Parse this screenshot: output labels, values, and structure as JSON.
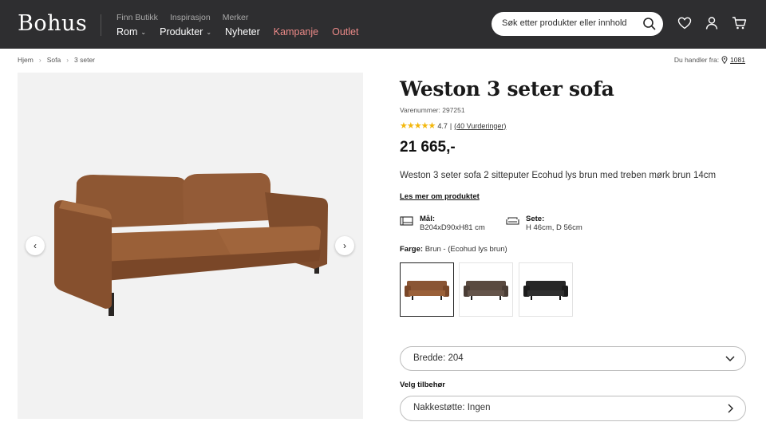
{
  "header": {
    "logo": "Bohus",
    "util_links": [
      "Finn Butikk",
      "Inspirasjon",
      "Merker"
    ],
    "nav": [
      {
        "label": "Rom",
        "chevron": true
      },
      {
        "label": "Produkter",
        "chevron": true
      },
      {
        "label": "Nyheter",
        "chevron": false
      },
      {
        "label": "Kampanje",
        "chevron": false
      },
      {
        "label": "Outlet",
        "chevron": false
      }
    ],
    "search_placeholder": "Søk etter produkter eller innhold ...",
    "icons": [
      "search-icon",
      "heart-icon",
      "user-icon",
      "cart-icon"
    ]
  },
  "breadcrumb": [
    "Hjem",
    "Sofa",
    "3 seter"
  ],
  "location": {
    "label": "Du handler fra:",
    "value": "1081"
  },
  "product": {
    "title": "Weston 3 seter sofa",
    "sku": "Varenummer: 297251",
    "rating": {
      "stars": 4.7,
      "score": "4.7",
      "separator": "|",
      "reviews": "(40 Vurderinger)"
    },
    "price": "21 665,-",
    "description": "Weston 3 seter sofa 2 sitteputer Ecohud lys brun med treben mørk brun 14cm",
    "read_more": "Les mer om produktet",
    "specs": [
      {
        "label": "Mål:",
        "value": "B204xD90xH81 cm"
      },
      {
        "label": "Sete:",
        "value": "H 46cm, D 56cm"
      }
    ],
    "color_label": "Farge:",
    "color_value": "Brun - (Ecohud lys brun)",
    "colors": [
      "#8a5534",
      "#5a4a40",
      "#262626"
    ],
    "width_select": "Bredde: 204",
    "accessory_label": "Velg tilbehør",
    "accessory_select": "Nakkestøtte: Ingen"
  },
  "colors": {
    "header_bg": "#2e2e30",
    "sale_text": "#ec8a88",
    "star": "#f3b70c"
  }
}
